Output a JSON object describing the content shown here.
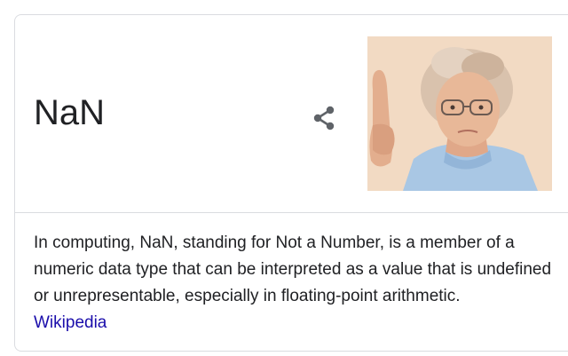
{
  "panel": {
    "title": "NaN",
    "description": "In computing, NaN, standing for Not a Number, is a member of a numeric data type that can be interpreted as a value that is undefined or unrepresentable, especially in floating-point arithmetic.",
    "source_label": "Wikipedia",
    "share_icon": "share-icon",
    "image_subject": "elderly woman with glasses raising index finger"
  },
  "colors": {
    "text": "#202124",
    "link": "#1a0dab",
    "divider": "#dadce0",
    "icon": "#5f6368"
  }
}
